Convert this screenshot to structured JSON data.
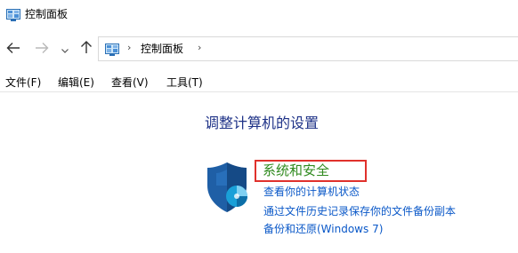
{
  "window": {
    "title": "控制面板",
    "title_icon": "control-panel-icon"
  },
  "nav": {
    "back_icon": "arrow-left-icon",
    "forward_icon": "arrow-right-icon",
    "recent_icon": "chevron-down-icon",
    "up_icon": "arrow-up-icon",
    "address": {
      "icon": "control-panel-icon",
      "separator": "›",
      "crumb": "控制面板",
      "trailing_separator": "›"
    }
  },
  "menu": {
    "items": [
      "文件(F)",
      "编辑(E)",
      "查看(V)",
      "工具(T)"
    ]
  },
  "content": {
    "heading": "调整计算机的设置",
    "categories": [
      {
        "icon": "shield-icon",
        "title": "系统和安全",
        "links": [
          "查看你的计算机状态",
          "通过文件历史记录保存你的文件备份副本",
          "备份和还原(Windows 7)"
        ]
      }
    ]
  },
  "colors": {
    "heading": "#1e3287",
    "category_title": "#2f8a1e",
    "link": "#0a58c8",
    "highlight_box": "#e0312c"
  }
}
